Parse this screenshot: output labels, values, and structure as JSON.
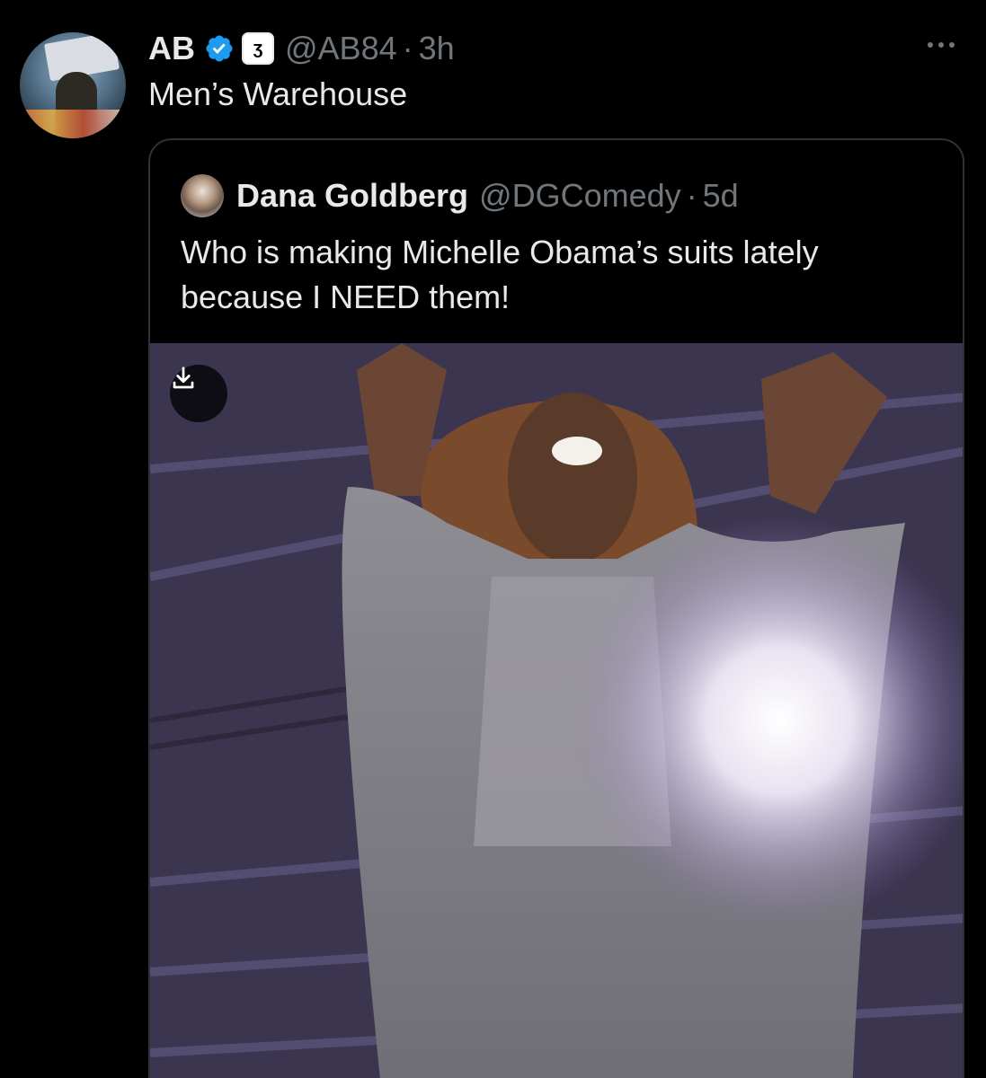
{
  "tweet": {
    "author_name": "AB",
    "verified_icon": "verified-badge-icon",
    "affiliate_badge_glyph": "ʒ",
    "handle": "@AB84",
    "separator": "·",
    "time": "3h",
    "text": "Men’s Warehouse",
    "more_icon": "more-options-icon"
  },
  "quoted_tweet": {
    "author_name": "Dana Goldberg",
    "handle": "@DGComedy",
    "separator": "·",
    "time": "5d",
    "text": "Who is making Michelle Obama’s suits lately because I NEED them!",
    "media_download_icon": "download-icon"
  },
  "colors": {
    "background": "#000000",
    "text": "#e7e9ea",
    "secondary_text": "#71767b",
    "verified_blue": "#1d9bf0",
    "border": "#2f3336"
  }
}
